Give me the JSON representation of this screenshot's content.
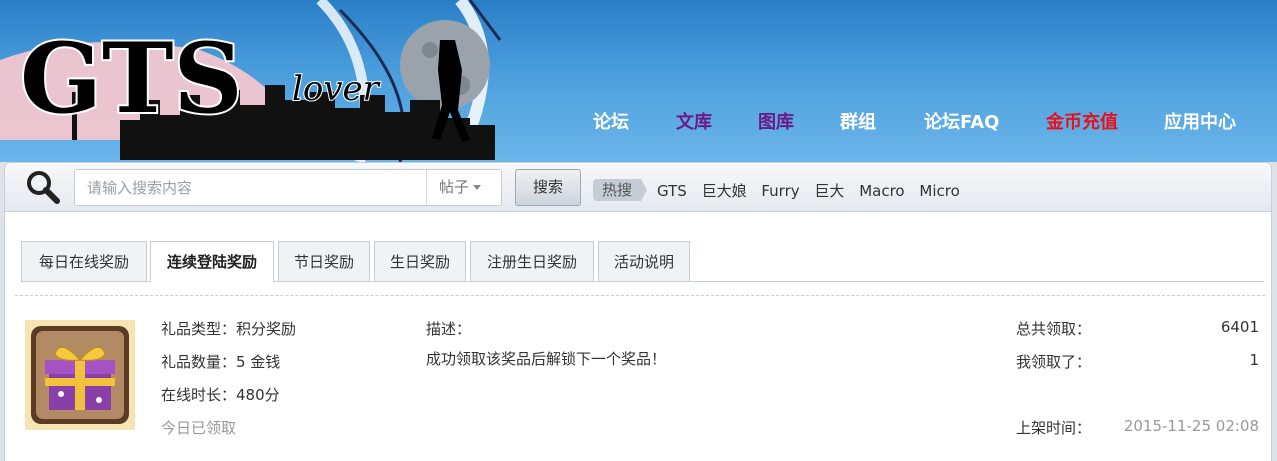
{
  "header": {
    "logo_text": "GTS",
    "logo_sub": "lover",
    "nav": [
      {
        "label": "论坛",
        "color": "#ffffff"
      },
      {
        "label": "文库",
        "color": "#6a1b8a"
      },
      {
        "label": "图库",
        "color": "#6a1b8a"
      },
      {
        "label": "群组",
        "color": "#ffffff"
      },
      {
        "label": "论坛FAQ",
        "color": "#ffffff"
      },
      {
        "label": "金币充值",
        "color": "#e8101b"
      },
      {
        "label": "应用中心",
        "color": "#ffffff"
      }
    ]
  },
  "search": {
    "icon": "search-icon",
    "placeholder": "请输入搜索内容",
    "type_label": "帖子",
    "button_label": "搜索",
    "hot_label": "热搜",
    "hot_words": [
      "GTS",
      "巨大娘",
      "Furry",
      "巨大",
      "Macro",
      "Micro"
    ]
  },
  "tabs": [
    {
      "label": "每日在线奖励",
      "active": false
    },
    {
      "label": "连续登陆奖励",
      "active": true
    },
    {
      "label": "节日奖励",
      "active": false
    },
    {
      "label": "生日奖励",
      "active": false
    },
    {
      "label": "注册生日奖励",
      "active": false
    },
    {
      "label": "活动说明",
      "active": false
    }
  ],
  "reward": {
    "icon": "gift-box-icon",
    "type": "礼品类型：积分奖励",
    "amount": "礼品数量：5 金钱",
    "online_time": "在线时长：480分",
    "status": "今日已领取",
    "desc_label": "描述：",
    "desc_text": "成功领取该奖品后解锁下一个奖品！",
    "total_label": "总共领取：",
    "total_value": "6401",
    "mine_label": "我领取了：",
    "mine_value": "1",
    "listed_label": "上架时间：",
    "listed_value": "2015-11-25 02:08"
  }
}
